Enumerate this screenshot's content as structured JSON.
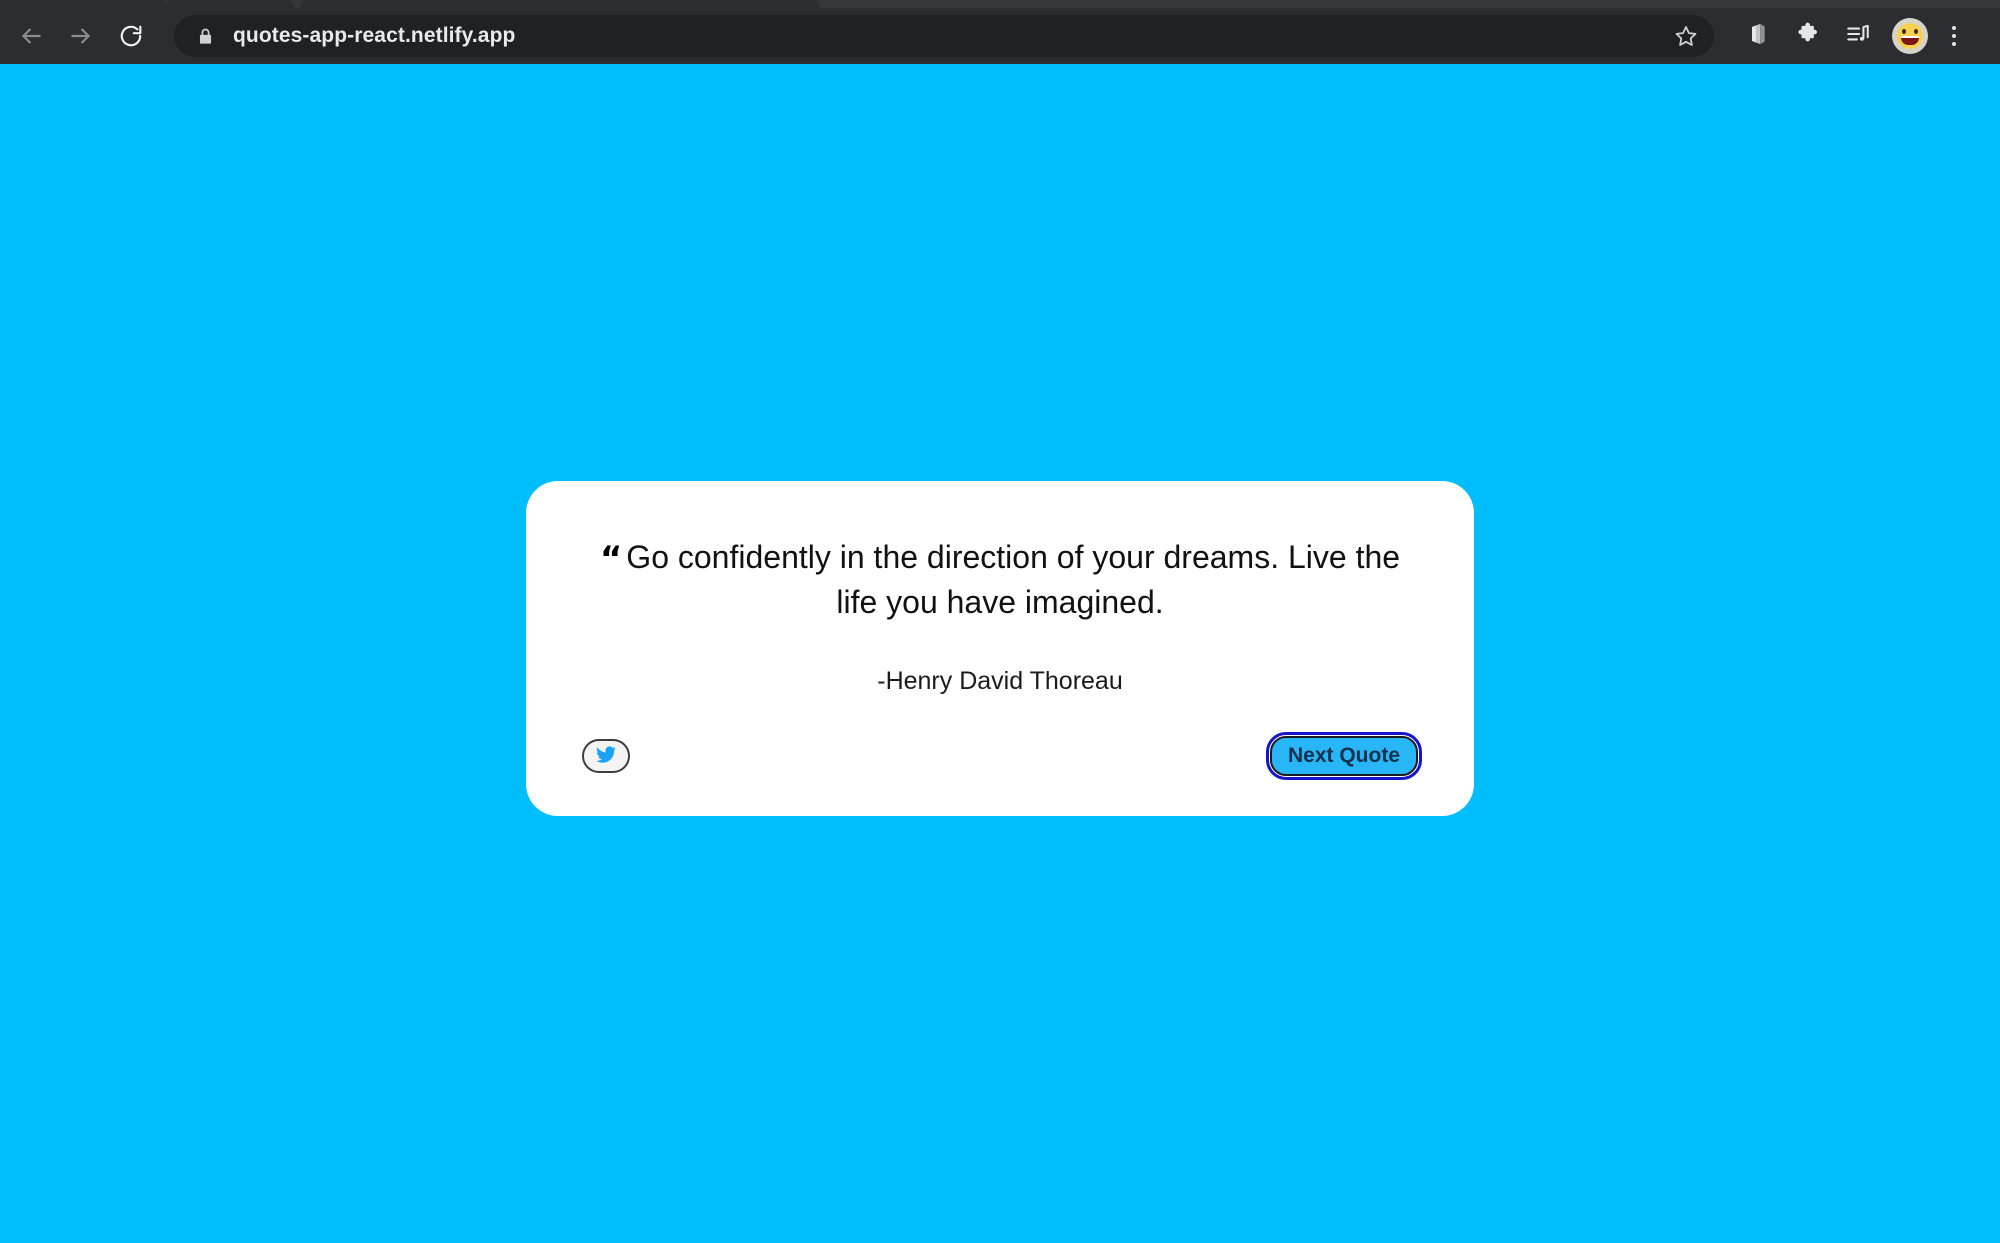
{
  "browser": {
    "url": "quotes-app-react.netlify.app",
    "lock_icon": "lock-icon",
    "back_icon": "back-arrow-icon",
    "forward_icon": "forward-arrow-icon",
    "reload_icon": "reload-icon",
    "bookmark_icon": "star-icon",
    "office_icon": "office-extension-icon",
    "extensions_icon": "puzzle-piece-icon",
    "media_icon": "media-playlist-icon",
    "avatar_icon": "smiley-avatar-icon",
    "menu_icon": "three-dot-menu-icon"
  },
  "page": {
    "background_color": "#00bdfc"
  },
  "card": {
    "quote_mark": "“",
    "quote_text": "Go confidently in the direction of your dreams. Live the life you have imagined.",
    "author": "-Henry David Thoreau",
    "twitter_label": "twitter-share",
    "next_button_label": "Next Quote",
    "accent_color": "#29b6f6",
    "focus_ring_color": "#1616c8",
    "card_background": "#ffffff"
  }
}
